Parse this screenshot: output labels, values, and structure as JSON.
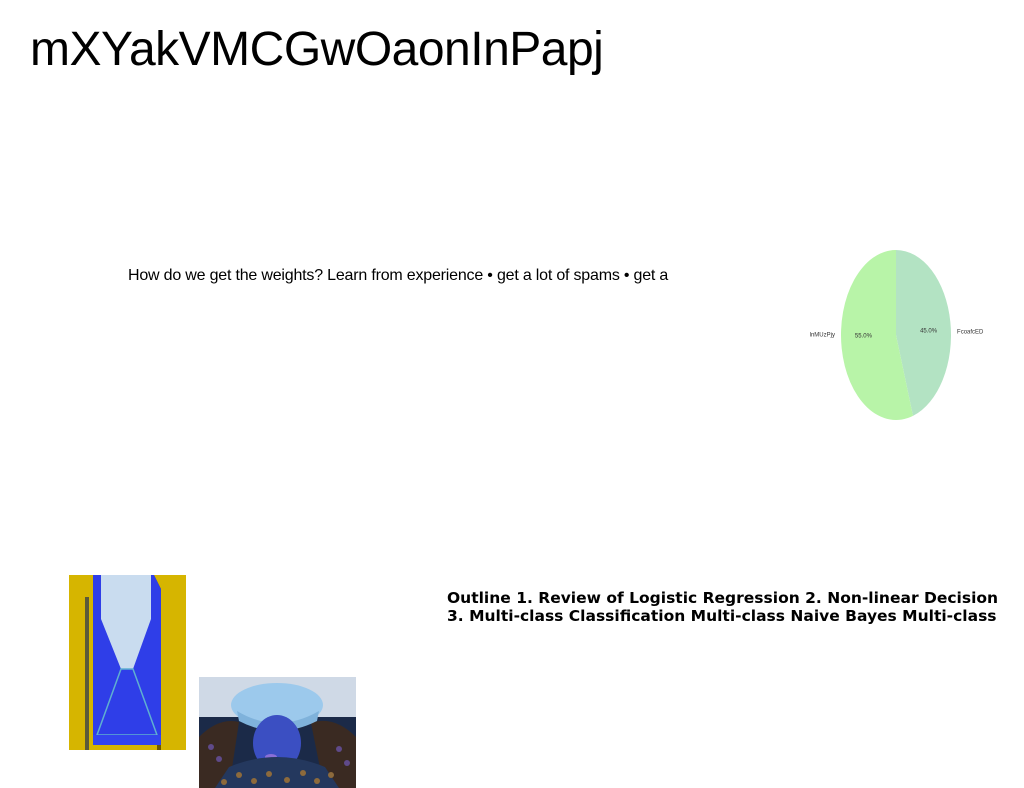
{
  "slide": {
    "title": "mXYakVMCGwOaonInPapj",
    "weights_text": "How do we get the weights? Learn from experience • get a lot of spams • get a",
    "outline": {
      "line1": "Outline 1. Review of Logistic Regression 2. Non-linear Decision",
      "line2": "3. Multi-class Classification Multi-class Naive Bayes Multi-class"
    }
  },
  "images": {
    "bottle": "blue bottle illustration on yellow background",
    "person": "person in bucket hat holding head"
  },
  "chart_data": {
    "type": "pie",
    "labels": [
      "FcoafcED",
      "lnMUzPjy"
    ],
    "values": [
      45.0,
      55.0
    ],
    "value_labels": [
      "45.0%",
      "55.0%"
    ],
    "colors": [
      "#b3e3c3",
      "#b8f4a8"
    ],
    "start_angle_deg": 90,
    "direction": "clockwise",
    "aspect": "vertically stretched ellipse"
  }
}
